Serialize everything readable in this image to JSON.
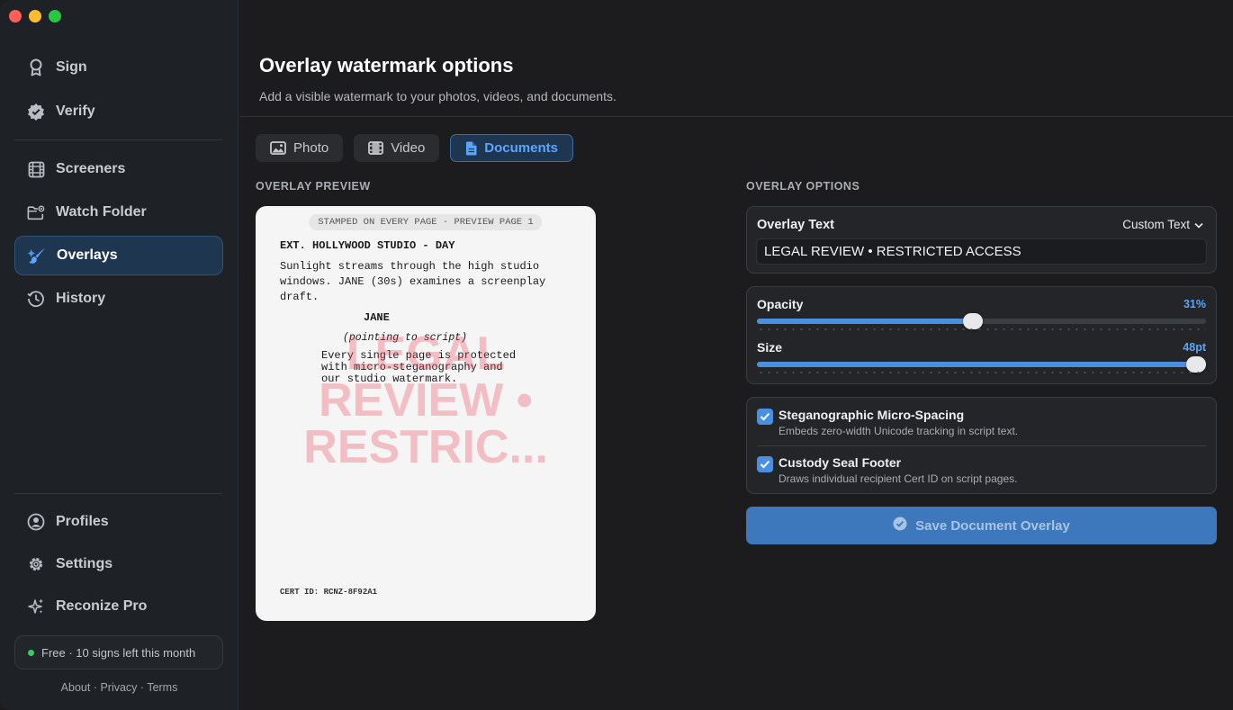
{
  "sidebar": {
    "items": [
      {
        "id": "sign",
        "label": "Sign",
        "icon": "ribbon-icon"
      },
      {
        "id": "verify",
        "label": "Verify",
        "icon": "verified-badge-icon"
      },
      {
        "id": "screeners",
        "label": "Screeners",
        "icon": "film-strip-icon"
      },
      {
        "id": "watch-folder",
        "label": "Watch Folder",
        "icon": "folder-badge-icon"
      },
      {
        "id": "overlays",
        "label": "Overlays",
        "icon": "paintbrush-icon",
        "active": true
      },
      {
        "id": "history",
        "label": "History",
        "icon": "history-icon"
      },
      {
        "id": "profiles",
        "label": "Profiles",
        "icon": "person-circle-icon"
      },
      {
        "id": "settings",
        "label": "Settings",
        "icon": "gear-icon"
      },
      {
        "id": "reconize-pro",
        "label": "Reconize Pro",
        "icon": "sparkles-icon"
      }
    ],
    "plan": "Free · 10 signs left this month",
    "footer_links": {
      "about": "About",
      "privacy": "Privacy",
      "terms": "Terms",
      "sep": " · "
    }
  },
  "header": {
    "title": "Overlay watermark options",
    "subtitle": "Add a visible watermark to your photos, videos, and documents."
  },
  "tabs": [
    {
      "label": "Photo",
      "icon": "photo-icon"
    },
    {
      "label": "Video",
      "icon": "film-icon"
    },
    {
      "label": "Documents",
      "icon": "document-icon",
      "active": true
    }
  ],
  "preview": {
    "section_label": "OVERLAY PREVIEW",
    "stamp": "STAMPED ON EVERY PAGE · PREVIEW PAGE 1",
    "scene_heading": "EXT. HOLLYWOOD STUDIO - DAY",
    "action_lines": [
      "Sunlight streams through the high studio",
      "windows. JANE (30s) examines a screenplay",
      "draft."
    ],
    "character": "JANE",
    "parenthetical": "(pointing to script)",
    "dialogue_lines": [
      "Every single page is protected",
      "with micro-steganography and",
      "our studio watermark."
    ],
    "watermark_lines": [
      "LEGAL",
      "REVIEW •",
      "RESTRIC..."
    ],
    "cert_id": "CERT ID: RCNZ-8F92A1"
  },
  "options": {
    "section_label": "OVERLAY OPTIONS",
    "overlay_text": {
      "label": "Overlay Text",
      "mode": "Custom Text",
      "value": "LEGAL REVIEW • RESTRICTED ACCESS"
    },
    "opacity": {
      "label": "Opacity",
      "display": "31%",
      "position_fraction": 0.48
    },
    "size": {
      "label": "Size",
      "display": "48pt",
      "position_fraction": 1.0
    },
    "checks": [
      {
        "title": "Steganographic Micro-Spacing",
        "desc": "Embeds zero-width Unicode tracking in script text.",
        "checked": true
      },
      {
        "title": "Custody Seal Footer",
        "desc": "Draws individual recipient Cert ID on script pages.",
        "checked": true
      }
    ],
    "save_label": "Save Document Overlay"
  },
  "colors": {
    "accent": "#4a90e2",
    "accent_text": "#5aa6ff",
    "active_bg": "#1f3650",
    "watermark": "#ec465a",
    "status_green": "#30d158"
  }
}
